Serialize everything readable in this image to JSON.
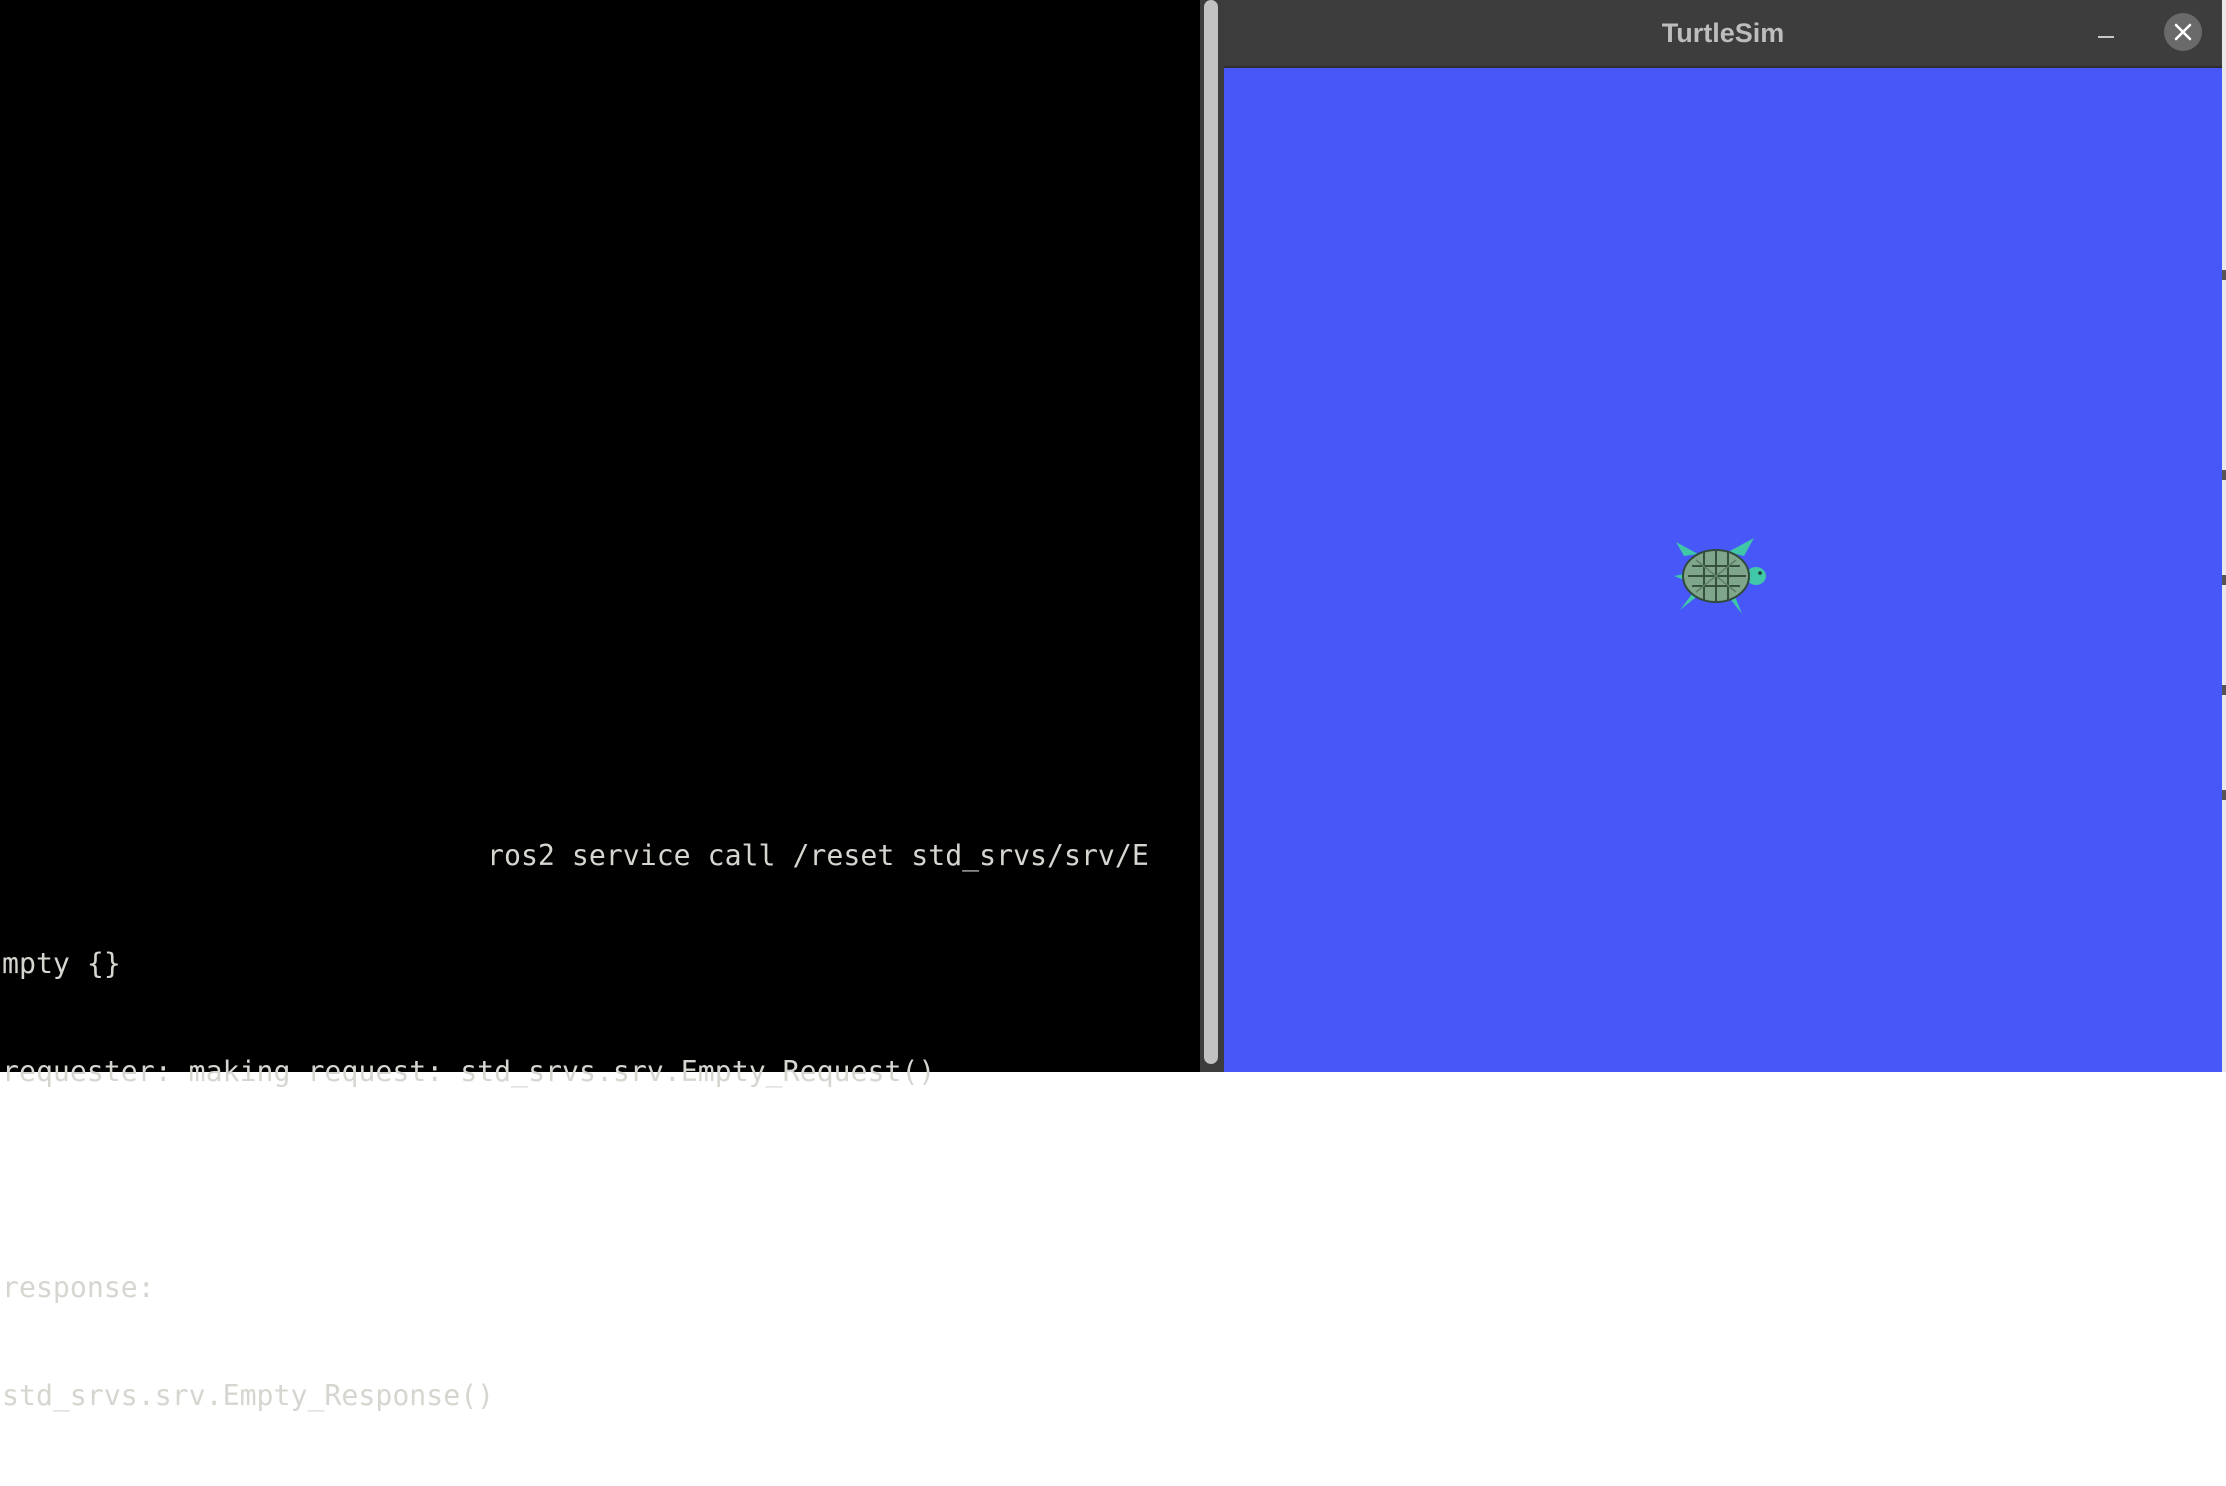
{
  "terminal": {
    "lines": [
      "ros2 service call /reset std_srvs/srv/E",
      "mpty {}",
      "requester: making request: std_srvs.srv.Empty_Request()",
      "",
      "response:",
      "std_srvs.srv.Empty_Response()"
    ]
  },
  "turtlesim": {
    "title": "TurtleSim",
    "background_color": "#4757f8",
    "turtle_icon": "turtle-icon"
  },
  "window_controls": {
    "minimize_icon": "minimize-icon",
    "close_icon": "close-icon"
  }
}
